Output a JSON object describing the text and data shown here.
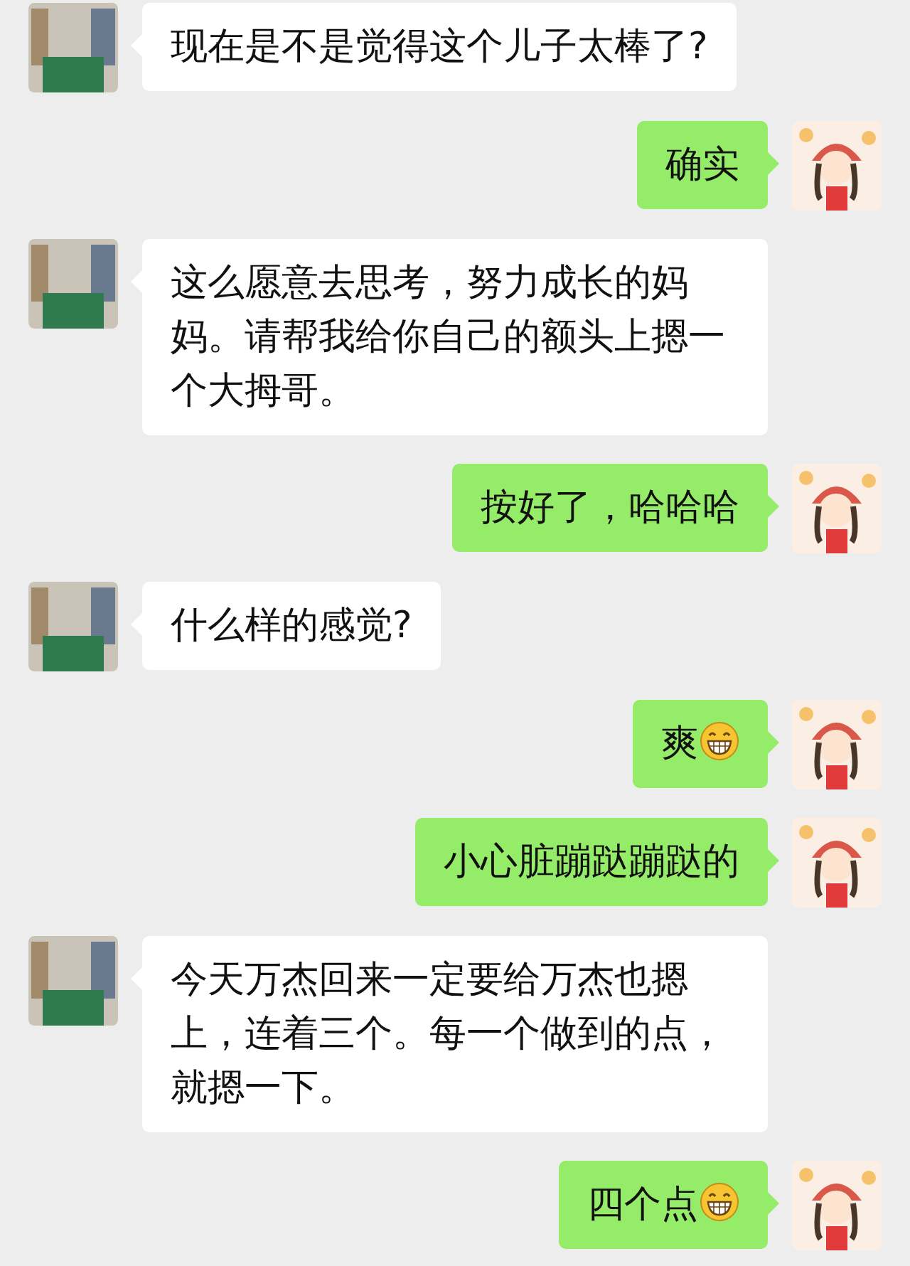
{
  "messages": [
    {
      "kind": "incoming",
      "text": "现在是不是觉得这个儿子太棒了?"
    },
    {
      "kind": "outgoing",
      "text": "确实"
    },
    {
      "kind": "incoming",
      "text": "这么愿意去思考，努力成长的妈妈。请帮我给你自己的额头上摁一个大拇哥。"
    },
    {
      "kind": "outgoing",
      "text": "按好了，哈哈哈"
    },
    {
      "kind": "incoming",
      "text": "什么样的感觉?"
    },
    {
      "kind": "outgoing",
      "text": "爽",
      "grin_emoji": true
    },
    {
      "kind": "outgoing",
      "text": "小心脏蹦跶蹦跶的"
    },
    {
      "kind": "incoming",
      "text": "今天万杰回来一定要给万杰也摁上，连着三个。每一个做到的点，就摁一下。"
    },
    {
      "kind": "outgoing",
      "text": "四个点",
      "grin_emoji": true
    }
  ]
}
